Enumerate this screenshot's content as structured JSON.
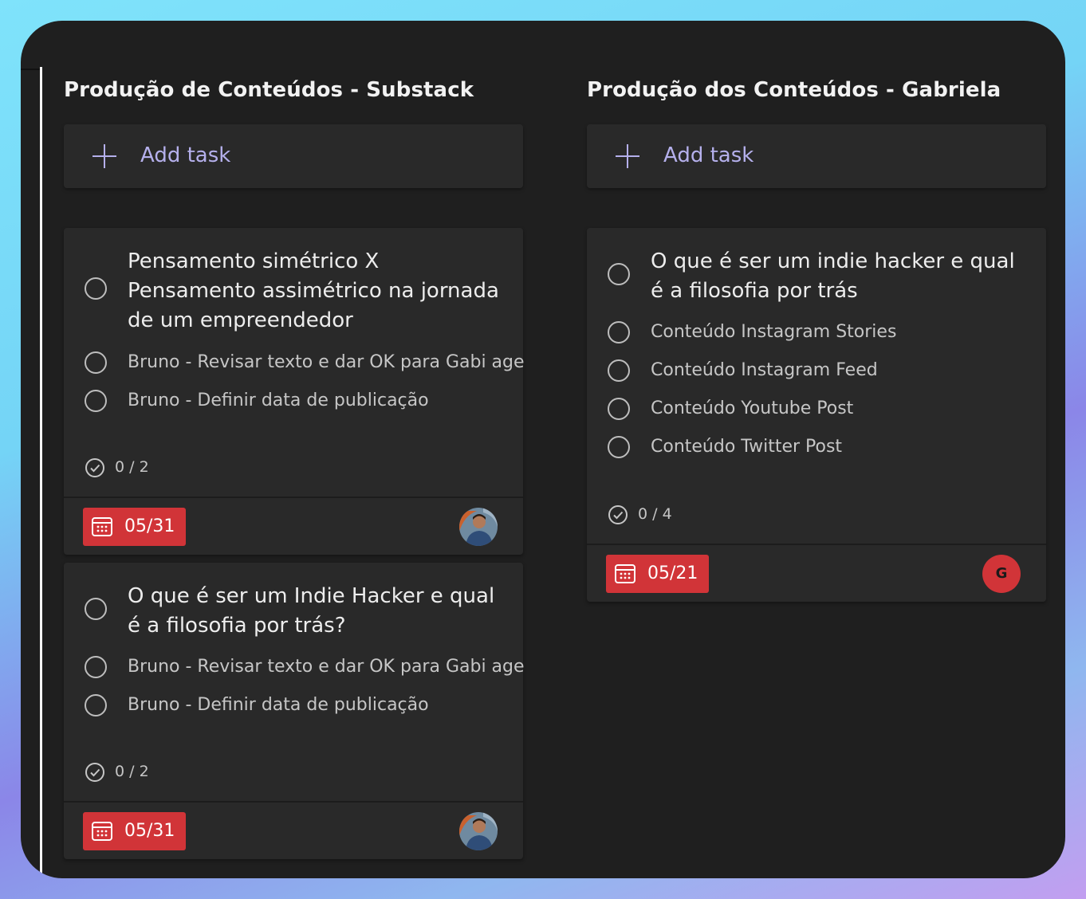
{
  "columns": [
    {
      "title": "Produção de Conteúdos - Substack",
      "add_task_label": "Add task",
      "cards": [
        {
          "title": "Pensamento simétrico X Pensamento assimétrico na jornada de um empreendedor",
          "checklist": [
            "Bruno - Revisar texto e dar OK para Gabi age",
            "Bruno - Definir data de publicação"
          ],
          "progress": "0 / 2",
          "due": "05/31",
          "assignee": "photo-avatar"
        },
        {
          "title": "O que é ser um Indie Hacker e qual é a filosofia por trás?",
          "checklist": [
            "Bruno - Revisar texto e dar OK para Gabi age",
            "Bruno - Definir data de publicação"
          ],
          "progress": "0 / 2",
          "due": "05/31",
          "assignee": "photo-avatar"
        }
      ]
    },
    {
      "title": "Produção dos Conteúdos - Gabriela",
      "add_task_label": "Add task",
      "cards": [
        {
          "title": "O que é ser um indie hacker e qual é a filosofia por trás",
          "checklist": [
            "Conteúdo Instagram Stories",
            "Conteúdo Instagram Feed",
            "Conteúdo Youtube Post",
            "Conteúdo Twitter Post"
          ],
          "progress": "0 / 4",
          "due": "05/21",
          "assignee_initial": "G"
        }
      ]
    }
  ],
  "colors": {
    "window_bg": "#1f1f1f",
    "card_bg": "#292929",
    "accent": "#b5b0ec",
    "due_badge": "#d13438"
  },
  "icons": {
    "add": "plus-icon",
    "checklist_item": "circle-icon",
    "progress": "check-circle-icon",
    "due": "calendar-icon"
  }
}
